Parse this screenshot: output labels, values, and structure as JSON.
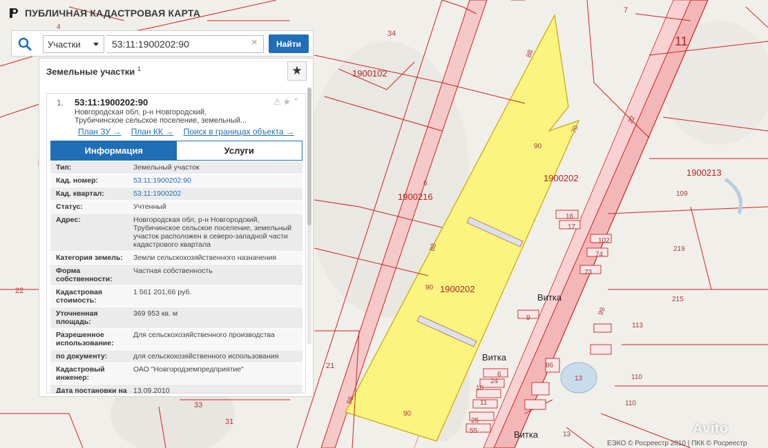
{
  "header": {
    "title": "ПУБЛИЧНАЯ КАДАСТРОВАЯ КАРТА"
  },
  "search": {
    "type_value": "Участки",
    "query_value": "53:11:1900202:90",
    "clear_glyph": "×",
    "button_label": "Найти"
  },
  "results": {
    "title": "Земельные участки",
    "count": "1",
    "favorite_glyph": "★",
    "item": {
      "number": "1.",
      "cad_number": "53:11:1900202:90",
      "address_line1": "Новгородская обл, р-н Новгородский,",
      "address_line2": "Трубичинское сельское поселение, земельный...",
      "tools": "⚠★⌃",
      "links": [
        "План ЗУ →",
        "План КК →",
        "Поиск в границах объекта →"
      ],
      "tabs": [
        "Информация",
        "Услуги"
      ],
      "rows": [
        {
          "key": "Тип:",
          "value": "Земельный участок",
          "link": false
        },
        {
          "key": "Кад. номер:",
          "value": "53:11:1900202:90",
          "link": true
        },
        {
          "key": "Кад. квартал:",
          "value": "53:11:1900202",
          "link": true
        },
        {
          "key": "Статус:",
          "value": "Учтенный",
          "link": false
        },
        {
          "key": "Адрес:",
          "value": "Новгородская обл, р-н Новгородский, Трубичинское сельское поселение, земельный участок расположен в северо-западной части кадастрового квартала",
          "link": false
        },
        {
          "key": "Категория земель:",
          "value": "Земли сельскохозяйственного назначения",
          "link": false
        },
        {
          "key": "Форма собственности:",
          "value": "Частная собственность",
          "link": false
        },
        {
          "key": "Кадастровая стоимость:",
          "value": "1 561 201,66 руб.",
          "link": false
        },
        {
          "key": "Уточненная площадь:",
          "value": "369 953 кв. м",
          "link": false
        },
        {
          "key": "Разрешенное использование:",
          "value": "Для сельскохозяйственного производства",
          "link": false
        },
        {
          "key": "по документу:",
          "value": "для сельскохозяйственного использования",
          "link": false
        },
        {
          "key": "Кадастровый инженер:",
          "value": "ОАО \"Новгородземпредприятие\"",
          "link": false
        },
        {
          "key": "Дата постановки на учет:",
          "value": "13.09.2010",
          "link": false
        }
      ]
    }
  },
  "map": {
    "labels": {
      "l_1900102": "1900102",
      "l_1900216": "1900216",
      "l_1900202a": "1900202",
      "l_1900202b": "1900202",
      "l_1900213": "1900213",
      "l_11": "11",
      "l_7": "7",
      "l_34": "34",
      "l_4": "4",
      "l_6": "6",
      "l_22": "22",
      "l_21": "21",
      "l_31": "31",
      "l_33": "33",
      "l_88a": "88",
      "l_88b": "88",
      "l_88c": "88",
      "l_70": "70",
      "l_90a": "90",
      "l_90b": "90",
      "l_90c": "90",
      "l_109": "109",
      "l_219": "219",
      "l_215": "215",
      "l_113": "113",
      "l_110a": "110",
      "l_110b": "110",
      "l_16": "16",
      "l_17": "17",
      "l_102": "102",
      "l_74": "74",
      "l_73": "73",
      "l_99": "99",
      "l_9": "9",
      "l_6b": "6",
      "l_24": "24",
      "l_10": "10",
      "l_11b": "11",
      "l_25": "25",
      "l_55": "55",
      "l_86": "86",
      "l_13a": "13",
      "l_13b": "13",
      "l_22b": "22",
      "vitka1": "Витка",
      "vitka2": "Витка",
      "vitka3": "Витка"
    },
    "colors": {
      "parcel_fill": "#fbf57f",
      "boundary": "#d22020",
      "road": "#f3b9b9"
    }
  },
  "footer": {
    "credits": "ЕЭКО © Росреестр 2010 | ПКК © Росреестр",
    "watermark": "Avito"
  }
}
